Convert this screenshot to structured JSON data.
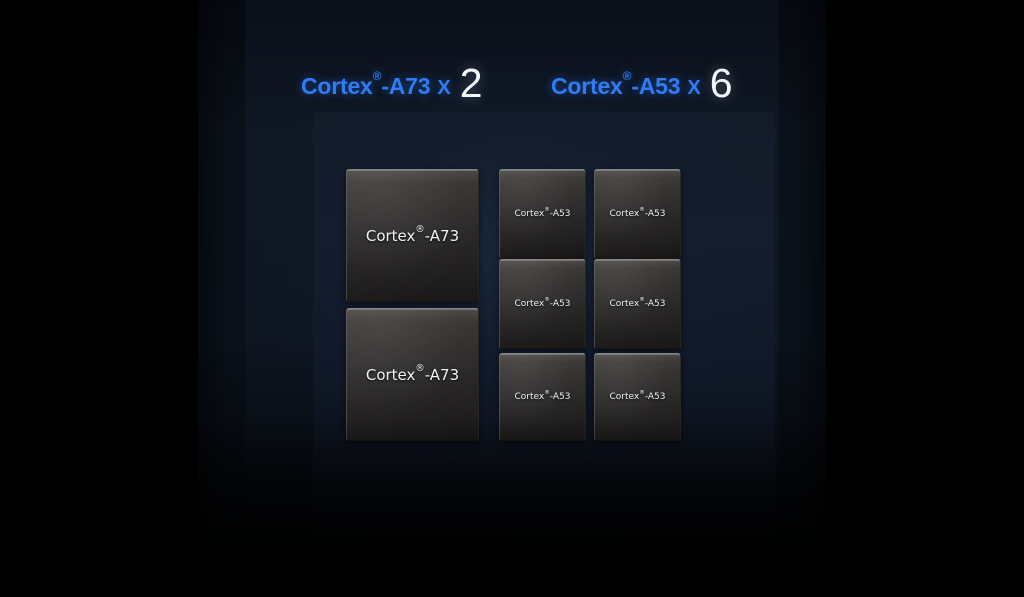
{
  "scene": {
    "title": "Octa-core CPU configuration diagram",
    "background_color": "#000000",
    "panel_color": "#131b29",
    "accent_color": "#2f7cf6",
    "count_color": "#f4f7fb",
    "tile_color": "#333130"
  },
  "headings": [
    {
      "id": "a73",
      "name": "Cortex",
      "registered": "®",
      "suffix": "-A73",
      "multiplier": "X",
      "count": "2"
    },
    {
      "id": "a53",
      "name": "Cortex",
      "registered": "®",
      "suffix": "-A53",
      "multiplier": "X",
      "count": "6"
    }
  ],
  "cores": {
    "big": [
      {
        "name": "Cortex",
        "registered": "®",
        "suffix": "-A73"
      },
      {
        "name": "Cortex",
        "registered": "®",
        "suffix": "-A73"
      }
    ],
    "small": [
      {
        "name": "Cortex",
        "registered": "®",
        "suffix": "-A53"
      },
      {
        "name": "Cortex",
        "registered": "®",
        "suffix": "-A53"
      },
      {
        "name": "Cortex",
        "registered": "®",
        "suffix": "-A53"
      },
      {
        "name": "Cortex",
        "registered": "®",
        "suffix": "-A53"
      },
      {
        "name": "Cortex",
        "registered": "®",
        "suffix": "-A53"
      },
      {
        "name": "Cortex",
        "registered": "®",
        "suffix": "-A53"
      }
    ]
  }
}
